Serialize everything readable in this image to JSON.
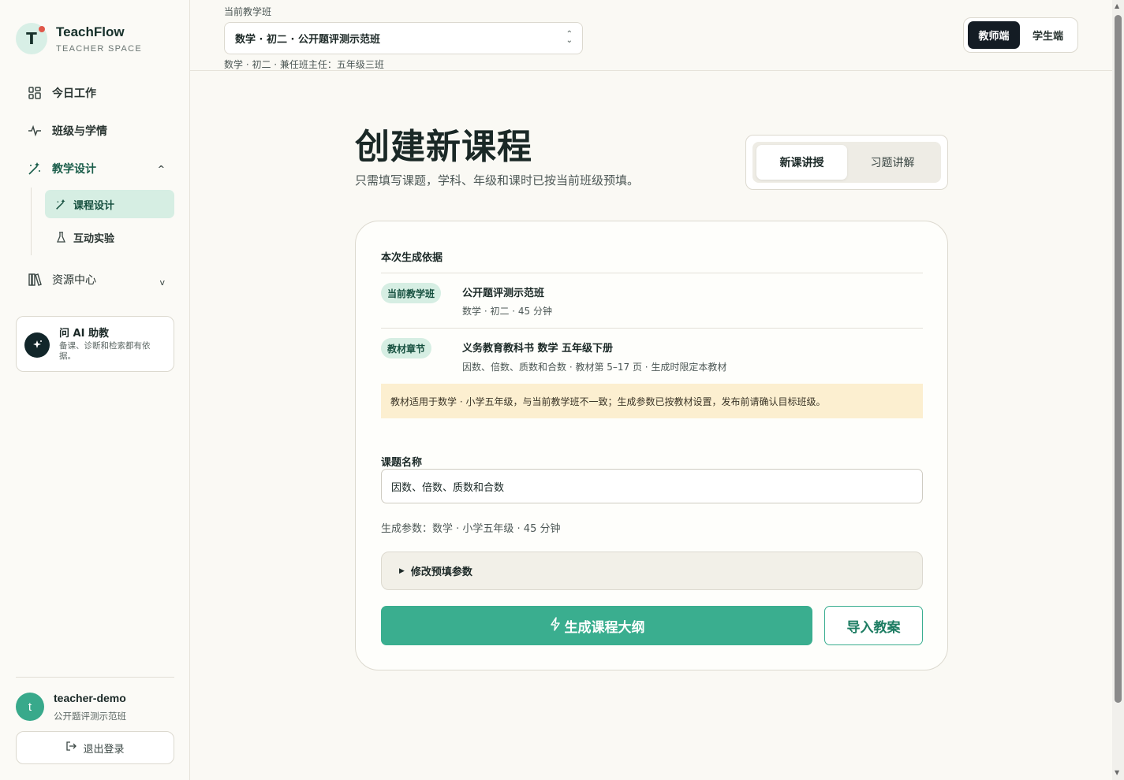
{
  "brand": {
    "logo_letter": "T",
    "name": "TeachFlow",
    "subtitle": "TEACHER SPACE"
  },
  "sidebar": {
    "items": [
      {
        "label": "今日工作",
        "icon": "grid-icon"
      },
      {
        "label": "班级与学情",
        "icon": "pulse-icon"
      },
      {
        "label": "教学设计",
        "icon": "magic-wand-icon",
        "expanded": true,
        "chevron": "^"
      },
      {
        "label": "资源中心",
        "icon": "books-icon",
        "expanded": false,
        "chevron": "v"
      }
    ],
    "sub_items": [
      {
        "label": "课程设计",
        "icon": "magic-wand-icon",
        "active": true
      },
      {
        "label": "互动实验",
        "icon": "flask-icon",
        "active": false
      }
    ],
    "ai_card": {
      "title": "问 AI 助教",
      "desc": "备课、诊断和检索都有依据。"
    },
    "user": {
      "avatar_letter": "t",
      "name": "teacher-demo",
      "class": "公开题评测示范班"
    },
    "logout_label": "退出登录"
  },
  "topbar": {
    "class_label": "当前教学班",
    "class_value": "数学 · 初二 · 公开题评测示范班",
    "class_meta": "数学 · 初二 · 兼任班主任：五年级三班",
    "roles": [
      {
        "label": "教师端",
        "active": true
      },
      {
        "label": "学生端",
        "active": false
      }
    ]
  },
  "main": {
    "title": "创建新课程",
    "subtitle": "只需填写课题，学科、年级和课时已按当前班级预填。",
    "modes": [
      {
        "label": "新课讲授",
        "active": true
      },
      {
        "label": "习题讲解",
        "active": false
      }
    ],
    "basis": {
      "title": "本次生成依据",
      "class_tag": "当前教学班",
      "class_name": "公开题评测示范班",
      "class_meta": "数学 · 初二 · 45 分钟",
      "textbook_tag": "教材章节",
      "textbook_name": "义务教育教科书 数学 五年级下册",
      "textbook_meta": "因数、倍数、质数和合数 · 教材第 5–17 页 · 生成时限定本教材",
      "warning": "教材适用于数学 · 小学五年级，与当前教学班不一致；生成参数已按教材设置，发布前请确认目标班级。"
    },
    "topic_label": "课题名称",
    "topic_value": "因数、倍数、质数和合数",
    "params": "生成参数：数学 · 小学五年级 · 45 分钟",
    "adjust_label": "修改预填参数",
    "generate_label": "生成课程大纲",
    "import_label": "导入教案"
  },
  "colors": {
    "accent": "#3aae8f",
    "accent_soft": "#d6eee3",
    "warning_bg": "#fcefd0",
    "dark": "#141c24"
  }
}
